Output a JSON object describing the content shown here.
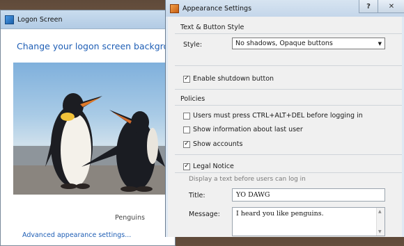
{
  "logon_window": {
    "title": "Logon Screen",
    "heading": "Change your logon screen background",
    "preview_caption": "Penguins",
    "advanced_link": "Advanced appearance settings..."
  },
  "appearance_window": {
    "title": "Appearance Settings",
    "help_label": "?",
    "close_label": "✕",
    "text_button_section": "Text & Button Style",
    "style_label": "Style:",
    "style_value": "No shadows, Opaque buttons",
    "enable_shutdown": {
      "label": "Enable shutdown button",
      "checked": true
    },
    "policies_section": "Policies",
    "policies": [
      {
        "label": "Users must press CTRL+ALT+DEL before logging in",
        "checked": false
      },
      {
        "label": "Show information about last user",
        "checked": false
      },
      {
        "label": "Show accounts",
        "checked": true
      }
    ],
    "legal_notice": {
      "label": "Legal Notice",
      "checked": true
    },
    "legal_hint": "Display a text before users can log in",
    "title_label": "Title:",
    "title_value": "YO DAWG",
    "message_label": "Message:",
    "message_value": "I heard you like penguins."
  },
  "colors": {
    "link": "#1e5eb5",
    "accent_icon": "#e07a2a"
  }
}
